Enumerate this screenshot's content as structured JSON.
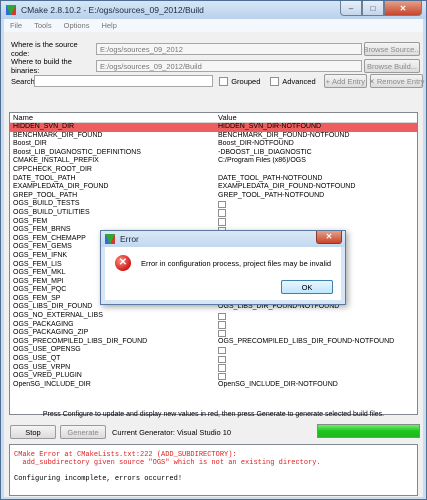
{
  "window": {
    "title": "CMake 2.8.10.2 - E:/ogs/sources_09_2012/Build",
    "min": "–",
    "max": "□",
    "close": "✕"
  },
  "menu": [
    "File",
    "Tools",
    "Options",
    "Help"
  ],
  "source": {
    "label": "Where is the source code:",
    "value": "E:/ogs/sources_09_2012",
    "button": "Browse Source..."
  },
  "binaries": {
    "label": "Where to build the binaries:",
    "value": "E:/ogs/sources_09_2012/Build",
    "button": "Browse Build..."
  },
  "search": {
    "label": "Search:",
    "value": "",
    "grouped": "Grouped",
    "advanced": "Advanced",
    "add": "Add Entry",
    "remove": "Remove Entry"
  },
  "table": {
    "headers": [
      "Name",
      "Value"
    ],
    "rows": [
      {
        "name": "HIDDEN_SVN_DIR",
        "value": "HIDDEN_SVN_DIR-NOTFOUND",
        "checkbox": false,
        "red": true
      },
      {
        "name": "BENCHMARK_DIR_FOUND",
        "value": "BENCHMARK_DIR_FOUND-NOTFOUND",
        "checkbox": false,
        "red": false
      },
      {
        "name": "Boost_DIR",
        "value": "Boost_DIR-NOTFOUND",
        "checkbox": false,
        "red": false
      },
      {
        "name": "Boost_LIB_DIAGNOSTIC_DEFINITIONS",
        "value": "-DBOOST_LIB_DIAGNOSTIC",
        "checkbox": false,
        "red": false
      },
      {
        "name": "CMAKE_INSTALL_PREFIX",
        "value": "C:/Program Files (x86)/OGS",
        "checkbox": false,
        "red": false
      },
      {
        "name": "CPPCHECK_ROOT_DIR",
        "value": "",
        "checkbox": false,
        "red": false
      },
      {
        "name": "DATE_TOOL_PATH",
        "value": "DATE_TOOL_PATH-NOTFOUND",
        "checkbox": false,
        "red": false
      },
      {
        "name": "EXAMPLEDATA_DIR_FOUND",
        "value": "EXAMPLEDATA_DIR_FOUND-NOTFOUND",
        "checkbox": false,
        "red": false
      },
      {
        "name": "GREP_TOOL_PATH",
        "value": "GREP_TOOL_PATH-NOTFOUND",
        "checkbox": false,
        "red": false
      },
      {
        "name": "OGS_BUILD_TESTS",
        "value": "",
        "checkbox": true,
        "red": false
      },
      {
        "name": "OGS_BUILD_UTILITIES",
        "value": "",
        "checkbox": true,
        "red": false
      },
      {
        "name": "OGS_FEM",
        "value": "",
        "checkbox": true,
        "red": false
      },
      {
        "name": "OGS_FEM_BRNS",
        "value": "",
        "checkbox": true,
        "red": false
      },
      {
        "name": "OGS_FEM_CHEMAPP",
        "value": "",
        "checkbox": true,
        "red": false
      },
      {
        "name": "OGS_FEM_GEMS",
        "value": "",
        "checkbox": true,
        "red": false
      },
      {
        "name": "OGS_FEM_IFNK",
        "value": "",
        "checkbox": true,
        "red": false
      },
      {
        "name": "OGS_FEM_LIS",
        "value": "",
        "checkbox": true,
        "red": false
      },
      {
        "name": "OGS_FEM_MKL",
        "value": "",
        "checkbox": true,
        "red": false
      },
      {
        "name": "OGS_FEM_MPI",
        "value": "",
        "checkbox": true,
        "red": false
      },
      {
        "name": "OGS_FEM_PQC",
        "value": "",
        "checkbox": true,
        "red": false
      },
      {
        "name": "OGS_FEM_SP",
        "value": "",
        "checkbox": true,
        "red": false
      },
      {
        "name": "OGS_LIBS_DIR_FOUND",
        "value": "OGS_LIBS_DIR_FOUND-NOTFOUND",
        "checkbox": false,
        "red": false
      },
      {
        "name": "OGS_NO_EXTERNAL_LIBS",
        "value": "",
        "checkbox": true,
        "red": false
      },
      {
        "name": "OGS_PACKAGING",
        "value": "",
        "checkbox": true,
        "red": false
      },
      {
        "name": "OGS_PACKAGING_ZIP",
        "value": "",
        "checkbox": true,
        "red": false
      },
      {
        "name": "OGS_PRECOMPILED_LIBS_DIR_FOUND",
        "value": "OGS_PRECOMPILED_LIBS_DIR_FOUND-NOTFOUND",
        "checkbox": false,
        "red": false
      },
      {
        "name": "OGS_USE_OPENSG",
        "value": "",
        "checkbox": true,
        "red": false
      },
      {
        "name": "OGS_USE_QT",
        "value": "",
        "checkbox": true,
        "red": false
      },
      {
        "name": "OGS_USE_VRPN",
        "value": "",
        "checkbox": true,
        "red": false
      },
      {
        "name": "OGS_VRED_PLUGIN",
        "value": "",
        "checkbox": true,
        "red": false
      },
      {
        "name": "OpenSG_INCLUDE_DIR",
        "value": "OpenSG_INCLUDE_DIR-NOTFOUND",
        "checkbox": false,
        "red": false
      }
    ]
  },
  "status_line": "Press Configure to update and display new values in red, then press Generate to generate selected build files.",
  "actions": {
    "stop": "Stop",
    "generate": "Generate",
    "generator": "Current Generator: Visual Studio 10"
  },
  "progress": {
    "fraction": 1.0
  },
  "output": {
    "lines": [
      {
        "text": "CMake Error at CMakeLists.txt:222 (ADD_SUBDIRECTORY):",
        "error": true
      },
      {
        "text": "  add_subdirectory given source \"OGS\" which is not an existing directory.",
        "error": true
      },
      {
        "text": "",
        "error": false
      },
      {
        "text": "Configuring incomplete, errors occurred!",
        "error": false
      }
    ]
  },
  "dialog": {
    "title": "Error",
    "message": "Error in configuration process, project files may be invalid",
    "ok": "OK",
    "close": "✕",
    "icon": "✕"
  },
  "colors": {
    "changed_row": "#ef5e5e",
    "error_text": "#e02020",
    "progress": "#1ec51e"
  }
}
